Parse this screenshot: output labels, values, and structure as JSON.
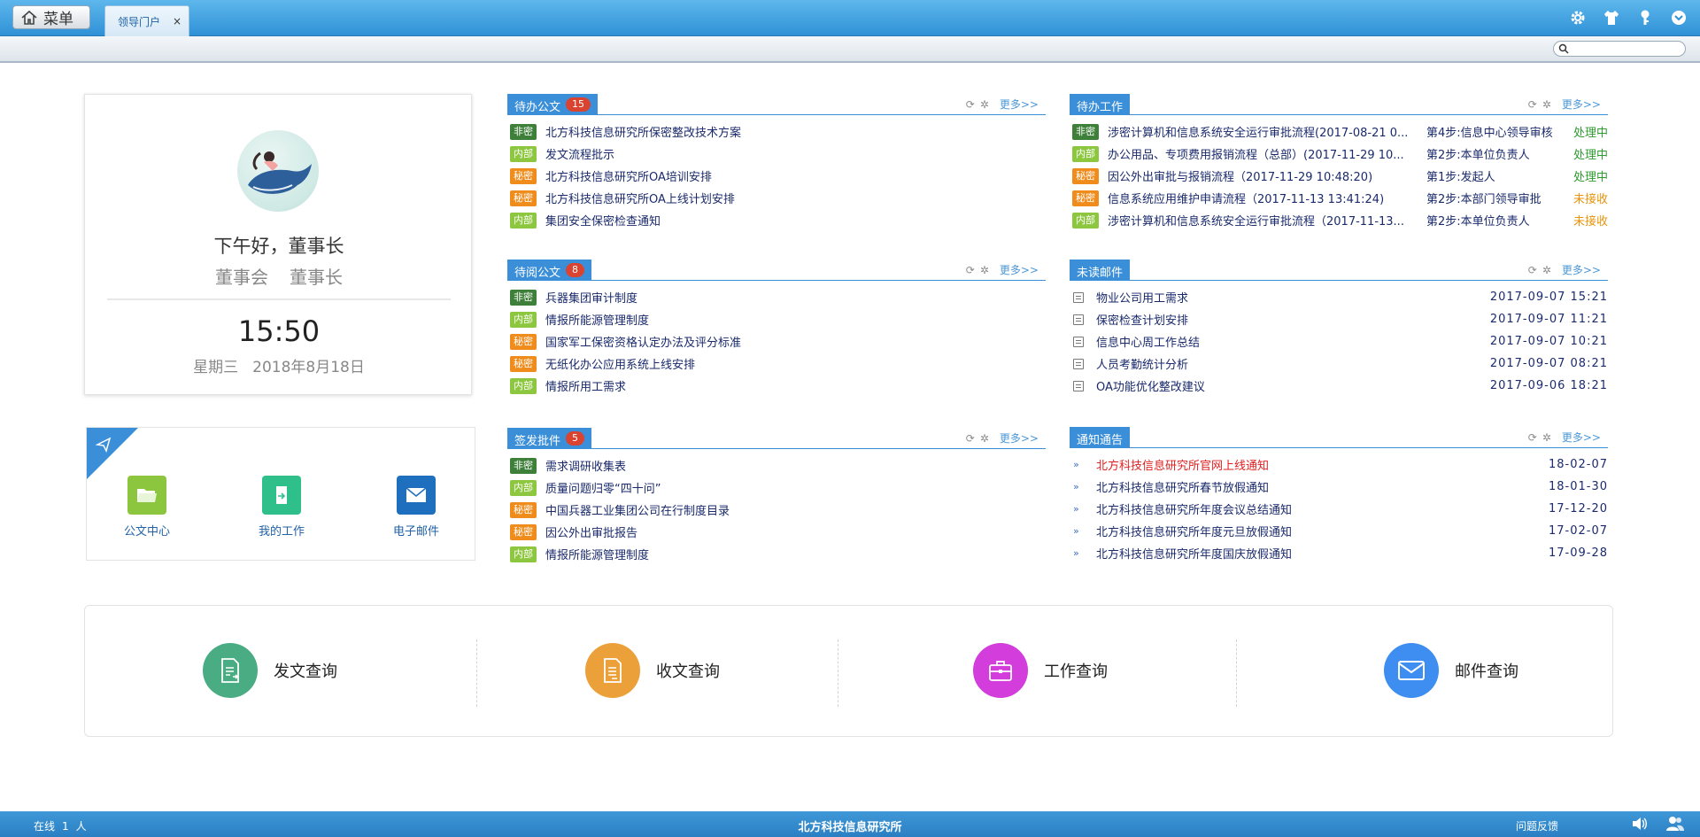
{
  "topbar": {
    "menu_label": "菜单",
    "tab_label": "领导门户",
    "tab_close": "×",
    "icons": [
      "gear-icon",
      "shirt-icon",
      "key-icon",
      "chevron-down-circle-icon"
    ]
  },
  "user": {
    "greeting": "下午好，董事长",
    "department": "董事会",
    "position": "董事长",
    "time": "15:50",
    "weekday": "星期三",
    "date": "2018年8月18日"
  },
  "quick_links": [
    {
      "label": "公文中心",
      "icon": "folder-icon",
      "color": "#8cc63f"
    },
    {
      "label": "我的工作",
      "icon": "document-arrow-icon",
      "color": "#2fbf8a"
    },
    {
      "label": "电子邮件",
      "icon": "envelope-icon",
      "color": "#1f6fbf"
    }
  ],
  "panels": {
    "pending_docs": {
      "title": "待办公文",
      "count": "15",
      "more": "更多>>",
      "rows": [
        {
          "tag": "非密",
          "tag_type": "fm",
          "text": "北方科技信息研究所保密整改技术方案"
        },
        {
          "tag": "内部",
          "tag_type": "nb",
          "text": "发文流程批示"
        },
        {
          "tag": "秘密",
          "tag_type": "mm",
          "text": "北方科技信息研究所OA培训安排"
        },
        {
          "tag": "秘密",
          "tag_type": "mm",
          "text": "北方科技信息研究所OA上线计划安排"
        },
        {
          "tag": "内部",
          "tag_type": "nb",
          "text": "集团安全保密检查通知"
        }
      ]
    },
    "pending_work": {
      "title": "待办工作",
      "more": "更多>>",
      "rows": [
        {
          "tag": "非密",
          "tag_type": "fm",
          "text": "涉密计算机和信息系统安全运行审批流程(2017-08-21 0...",
          "step": "第4步:信息中心领导审核",
          "status": "处理中",
          "status_color": "#2e9b2e"
        },
        {
          "tag": "内部",
          "tag_type": "nb",
          "text": "办公用品、专项费用报销流程（总部）(2017-11-29 10...",
          "step": "第2步:本单位负责人",
          "status": "处理中",
          "status_color": "#2e9b2e"
        },
        {
          "tag": "秘密",
          "tag_type": "mm",
          "text": "因公外出审批与报销流程（2017-11-29 10:48:20)",
          "step": "第1步:发起人",
          "status": "处理中",
          "status_color": "#2e9b2e"
        },
        {
          "tag": "秘密",
          "tag_type": "mm",
          "text": "信息系统应用维护申请流程（2017-11-13 13:41:24)",
          "step": "第2步:本部门领导审批",
          "status": "未接收",
          "status_color": "#e8940c"
        },
        {
          "tag": "内部",
          "tag_type": "nb",
          "text": "涉密计算机和信息系统安全运行审批流程（2017-11-13...",
          "step": "第2步:本单位负责人",
          "status": "未接收",
          "status_color": "#e8940c"
        }
      ]
    },
    "to_read": {
      "title": "待阅公文",
      "count": "8",
      "more": "更多>>",
      "rows": [
        {
          "tag": "非密",
          "tag_type": "fm",
          "text": "兵器集团审计制度"
        },
        {
          "tag": "内部",
          "tag_type": "nb",
          "text": "情报所能源管理制度"
        },
        {
          "tag": "秘密",
          "tag_type": "mm",
          "text": "国家军工保密资格认定办法及评分标准"
        },
        {
          "tag": "秘密",
          "tag_type": "mm",
          "text": "无纸化办公应用系统上线安排"
        },
        {
          "tag": "内部",
          "tag_type": "nb",
          "text": "情报所用工需求"
        }
      ]
    },
    "unread_mail": {
      "title": "未读邮件",
      "more": "更多>>",
      "rows": [
        {
          "text": "物业公司用工需求",
          "date": "2017-09-07 15:21"
        },
        {
          "text": "保密检查计划安排",
          "date": "2017-09-07 11:21"
        },
        {
          "text": "信息中心周工作总结",
          "date": "2017-09-07 10:21"
        },
        {
          "text": "人员考勤统计分析",
          "date": "2017-09-07 08:21"
        },
        {
          "text": "OA功能优化整改建议",
          "date": "2017-09-06 18:21"
        }
      ]
    },
    "sign_issue": {
      "title": "签发批件",
      "count": "5",
      "more": "更多>>",
      "rows": [
        {
          "tag": "非密",
          "tag_type": "fm",
          "text": "需求调研收集表"
        },
        {
          "tag": "内部",
          "tag_type": "nb",
          "text": "质量问题归零“四十问”"
        },
        {
          "tag": "秘密",
          "tag_type": "mm",
          "text": "中国兵器工业集团公司在行制度目录"
        },
        {
          "tag": "秘密",
          "tag_type": "mm",
          "text": "因公外出审批报告"
        },
        {
          "tag": "内部",
          "tag_type": "nb",
          "text": "情报所能源管理制度"
        }
      ]
    },
    "notices": {
      "title": "通知通告",
      "more": "更多>>",
      "rows": [
        {
          "text": "北方科技信息研究所官网上线通知",
          "date": "18-02-07",
          "color": "#e02020"
        },
        {
          "text": "北方科技信息研究所春节放假通知",
          "date": "18-01-30",
          "color": "#1a2a6c"
        },
        {
          "text": "北方科技信息研究所年度会议总结通知",
          "date": "17-12-20",
          "color": "#1a2a6c"
        },
        {
          "text": "北方科技信息研究所年度元旦放假通知",
          "date": "17-02-07",
          "color": "#1a2a6c"
        },
        {
          "text": "北方科技信息研究所年度国庆放假通知",
          "date": "17-09-28",
          "color": "#1a2a6c"
        }
      ]
    }
  },
  "queries": [
    {
      "label": "发文查询",
      "color": "#4aac82",
      "icon": "document-out-icon"
    },
    {
      "label": "收文查询",
      "color": "#eba03a",
      "icon": "document-in-icon"
    },
    {
      "label": "工作查询",
      "color": "#d23ddb",
      "icon": "briefcase-icon"
    },
    {
      "label": "邮件查询",
      "color": "#3d8ef0",
      "icon": "envelope-icon"
    }
  ],
  "footer": {
    "online_label": "在线",
    "online_count": "1",
    "online_unit": "人",
    "org": "北方科技信息研究所",
    "feedback": "问题反馈"
  }
}
